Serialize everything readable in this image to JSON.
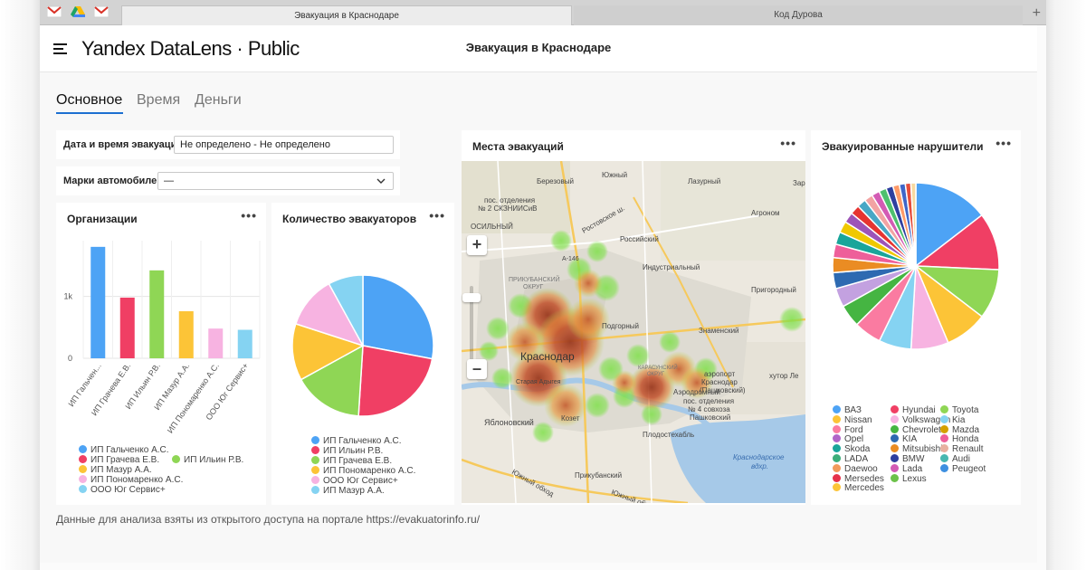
{
  "browser": {
    "tabs": [
      {
        "title": "Эвакуация в Краснодаре",
        "active": true
      },
      {
        "title": "Код Дурова",
        "active": false
      }
    ],
    "pinned": [
      "gmail-icon",
      "drive-icon",
      "gmail-icon"
    ]
  },
  "app": {
    "brand": "Yandex DataLens · Public",
    "title": "Эвакуация в Краснодаре"
  },
  "tabs": [
    "Основное",
    "Время",
    "Деньги"
  ],
  "filters": {
    "date_label": "Дата и время эвакуации",
    "date_value": "Не определено - Не определено",
    "brand_label": "Марки автомобилей",
    "brand_value": "—"
  },
  "cards": {
    "orgs_title": "Организации",
    "evac_count_title": "Количество эвакуаторов",
    "map_title": "Места эвакуаций",
    "violators_title": "Эвакуированные нарушители",
    "menu_glyph": "•••"
  },
  "orgs_chart": {
    "chart_data": {
      "type": "bar",
      "categories": [
        "ИП Гальчен...",
        "ИП Грачева Е.В.",
        "ИП Ильин Р.В.",
        "ИП Мазур А.А.",
        "ИП Пономаренко А.С.",
        "ООО Юг Сервис+"
      ],
      "values": [
        1800,
        980,
        1420,
        760,
        480,
        460
      ],
      "colors": [
        "#4da3f5",
        "#f03f64",
        "#8fd655",
        "#fcc437",
        "#f7b3e1",
        "#85d3f2"
      ],
      "y_ticks": [
        "0",
        "1k"
      ],
      "ylim": [
        0,
        1900
      ]
    },
    "legend": [
      {
        "label": "ИП Гальченко А.С.",
        "color": "#4da3f5"
      },
      {
        "label": "ИП Грачева Е.В.",
        "color": "#f03f64"
      },
      {
        "label": "ИП Ильин Р.В.",
        "color": "#8fd655"
      },
      {
        "label": "ИП Мазур А.А.",
        "color": "#fcc437"
      },
      {
        "label": "ИП Пономаренко А.С.",
        "color": "#f7b3e1"
      },
      {
        "label": "ООО Юг Сервис+",
        "color": "#85d3f2"
      }
    ]
  },
  "evac_chart": {
    "chart_data": {
      "type": "pie",
      "values": [
        28,
        23,
        16,
        13,
        12,
        8
      ],
      "colors": [
        "#4da3f5",
        "#f03f64",
        "#8fd655",
        "#fcc437",
        "#f7b3e1",
        "#85d3f2"
      ]
    },
    "legend": [
      {
        "label": "ИП Гальченко А.С.",
        "color": "#4da3f5"
      },
      {
        "label": "ИП Ильин Р.В.",
        "color": "#f03f64"
      },
      {
        "label": "ИП Грачева Е.В.",
        "color": "#8fd655"
      },
      {
        "label": "ИП Пономаренко А.С.",
        "color": "#fcc437"
      },
      {
        "label": "ООО Юг Сервис+",
        "color": "#f7b3e1"
      },
      {
        "label": "ИП Мазур А.А.",
        "color": "#85d3f2"
      }
    ]
  },
  "violators_chart": {
    "chart_data": {
      "type": "pie",
      "values": [
        15,
        11.5,
        10,
        8.5,
        7.5,
        6.5,
        5.5,
        4.5,
        3.8,
        3.2,
        3,
        2.7,
        2.5,
        2.3,
        2.1,
        1.9,
        1.8,
        1.7,
        1.6,
        1.5,
        1.4,
        1.3,
        1.2,
        1.1,
        1
      ],
      "colors": [
        "#4da3f5",
        "#f03f64",
        "#8fd655",
        "#fcc437",
        "#f7b3e1",
        "#85d3f2",
        "#fa7ba1",
        "#45b542",
        "#c3a1e0",
        "#2d6ab1",
        "#ea8c23",
        "#ee5f9a",
        "#19a59a",
        "#f0c800",
        "#9d54b7",
        "#e63431",
        "#48a7c5",
        "#f2a3a3",
        "#d35bb4",
        "#4fc06e",
        "#2e3f9f",
        "#fe9a68",
        "#3f66c8",
        "#e64d3b",
        "#f7d9a0"
      ]
    },
    "legend": [
      {
        "label": "ВАЗ",
        "color": "#4da3f5"
      },
      {
        "label": "Hyundai",
        "color": "#f03f64"
      },
      {
        "label": "Toyota",
        "color": "#8fd655"
      },
      {
        "label": "Nissan",
        "color": "#fcc437"
      },
      {
        "label": "Volkswagen",
        "color": "#f7b3e1"
      },
      {
        "label": "Kia",
        "color": "#85d3f2"
      },
      {
        "label": "Ford",
        "color": "#fa7ba1"
      },
      {
        "label": "Chevrolet",
        "color": "#45b542"
      },
      {
        "label": "Mazda",
        "color": "#d4a000"
      },
      {
        "label": "Opel",
        "color": "#b164c8"
      },
      {
        "label": "KIA",
        "color": "#2d6ab1"
      },
      {
        "label": "Honda",
        "color": "#ee5f9a"
      },
      {
        "label": "Skoda",
        "color": "#19a59a"
      },
      {
        "label": "Mitsubishi",
        "color": "#ea8c23"
      },
      {
        "label": "Renault",
        "color": "#e8b0a0"
      },
      {
        "label": "LADA",
        "color": "#3cae7a"
      },
      {
        "label": "BMW",
        "color": "#2e3f9f"
      },
      {
        "label": "Audi",
        "color": "#48b7b0"
      },
      {
        "label": "Daewoo",
        "color": "#f19a5b"
      },
      {
        "label": "Lada",
        "color": "#d35bb4"
      },
      {
        "label": "Peugeot",
        "color": "#3d8fe0"
      },
      {
        "label": "Mersedes",
        "color": "#e6314a"
      },
      {
        "label": "Lexus",
        "color": "#6cc24a"
      },
      {
        "label": "Mercedes",
        "color": "#fcc437"
      }
    ]
  },
  "map": {
    "labels": [
      "Южный",
      "Березовый",
      "Лазурный",
      "Зар",
      "пос. отделения",
      "№ 2 СКЗНИИСиВ",
      "Ростовское ш.",
      "Российский",
      "Агроном",
      "ОСИЛЬНЫЙ",
      "А-146",
      "ПРИКУБАНСКИЙ",
      "ОКРУГ",
      "Индустриальный",
      "Пригородный",
      "Подгорный",
      "Знаменский",
      "Краснодар",
      "КАРАСУНСКИЙ",
      "ОКРУГ",
      "аэропорт",
      "Краснодар",
      "(Пашковский)",
      "хутор Ле",
      "Аэродромный",
      "пос. отделения",
      "№ 4 совхоза",
      "Пашковский",
      "Яблоновский",
      "Козет",
      "Плодостехабль",
      "Краснодарское",
      "вдхр.",
      "Южный обход",
      "Прикубанский",
      "Южный обход",
      "Старая Адыгея"
    ],
    "zoom_in": "+",
    "zoom_out": "–"
  },
  "footer": "Данные для анализа взяты из открытого доступа на портале https://evakuatorinfo.ru/"
}
